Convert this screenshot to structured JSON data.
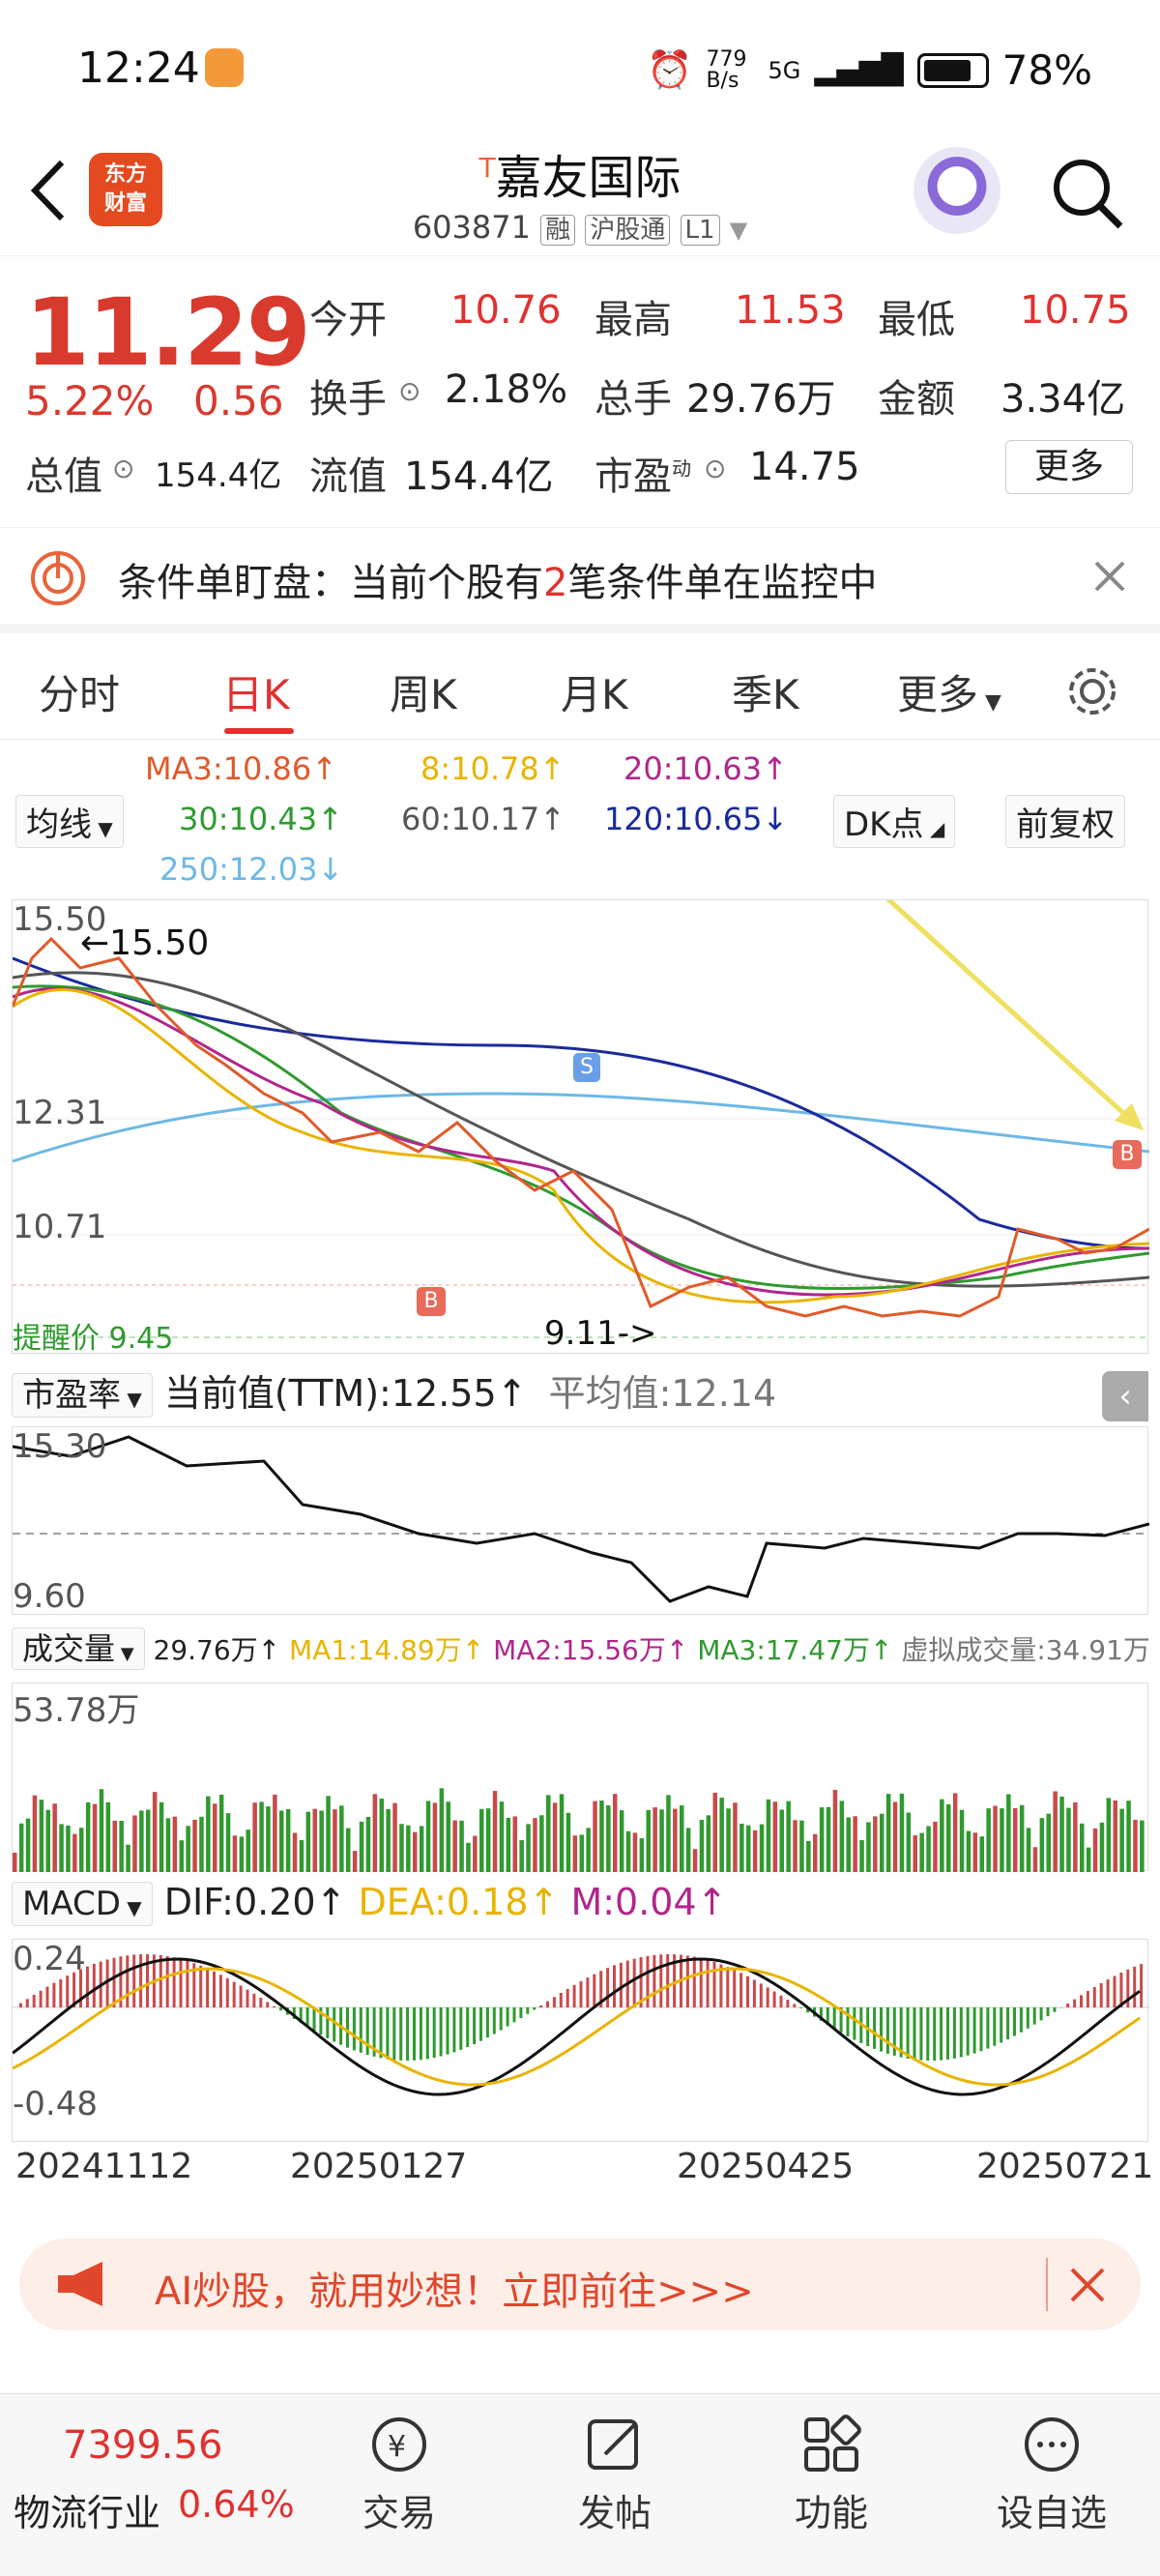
{
  "status_bar": {
    "time": "12:24",
    "net_speed": "779 B/s",
    "signal": "5G",
    "battery": "78%"
  },
  "header": {
    "logo_line1": "东方",
    "logo_line2": "财富",
    "stock_prefix": "T",
    "stock_name": "嘉友国际",
    "code": "603871",
    "tag_margin": "融",
    "tag_connect": "沪股通",
    "tag_level": "L1"
  },
  "quote": {
    "price": "11.29",
    "change_pct": "5.22%",
    "change": "0.56",
    "open_label": "今开",
    "open": "10.76",
    "high_label": "最高",
    "high": "11.53",
    "low_label": "最低",
    "low": "10.75",
    "turnover_label": "换手",
    "turnover": "2.18%",
    "volume_label": "总手",
    "volume": "29.76万",
    "amount_label": "金额",
    "amount": "3.34亿",
    "mktcap_label": "总值",
    "mktcap": "154.4亿",
    "float_label": "流值",
    "float": "154.4亿",
    "pe_label": "市盈",
    "pe_sup": "动",
    "pe": "14.75",
    "more": "更多"
  },
  "condition": {
    "prefix": "条件单盯盘：当前个股有",
    "count": "2",
    "suffix": "笔条件单在监控中"
  },
  "tabs": [
    "分时",
    "日K",
    "周K",
    "月K",
    "季K",
    "更多"
  ],
  "ma_legend": {
    "selector": "均线",
    "ma3": "MA3:10.86↑",
    "ma8": "8:10.78↑",
    "ma20": "20:10.63↑",
    "ma30": "30:10.43↑",
    "ma60": "60:10.17↑",
    "ma120": "120:10.65↓",
    "ma250": "250:12.03↓",
    "dk": "DK点",
    "fq": "前复权",
    "colors": {
      "ma3": "#e05a2a",
      "ma8": "#e8b400",
      "ma20": "#b0268c",
      "ma30": "#2f9a2f",
      "ma60": "#555555",
      "ma120": "#1a2a9c",
      "ma250": "#6db8e6"
    }
  },
  "kline": {
    "y_top": "15.50",
    "y_mid": "12.31",
    "y_low": "10.71",
    "high_mark": "←15.50",
    "low_mark": "9.11->",
    "alert": "提醒价 9.45"
  },
  "pe_panel": {
    "selector": "市盈率",
    "current": "当前值(TTM):12.55↑",
    "average": "平均值:12.14",
    "y_top": "15.30",
    "y_bottom": "9.60"
  },
  "vol_panel": {
    "selector": "成交量",
    "vol": "29.76万↑",
    "ma1": "MA1:14.89万↑",
    "ma2": "MA2:15.56万↑",
    "ma3": "MA3:17.47万↑",
    "virtual": "虚拟成交量:34.91万",
    "y_top": "53.78万"
  },
  "macd_panel": {
    "selector": "MACD",
    "dif": "DIF:0.20↑",
    "dea": "DEA:0.18↑",
    "m": "M:0.04↑",
    "y_top": "0.24",
    "y_bottom": "-0.48"
  },
  "dates": [
    "20241112",
    "20250127",
    "20250425",
    "20250721"
  ],
  "ai_banner": "AI炒股，就用妙想！立即前往>>>",
  "bottom_nav": {
    "index_value": "7399.56",
    "industry": "物流行业",
    "industry_change": "0.64%",
    "items": [
      "交易",
      "发帖",
      "功能",
      "设自选"
    ]
  }
}
